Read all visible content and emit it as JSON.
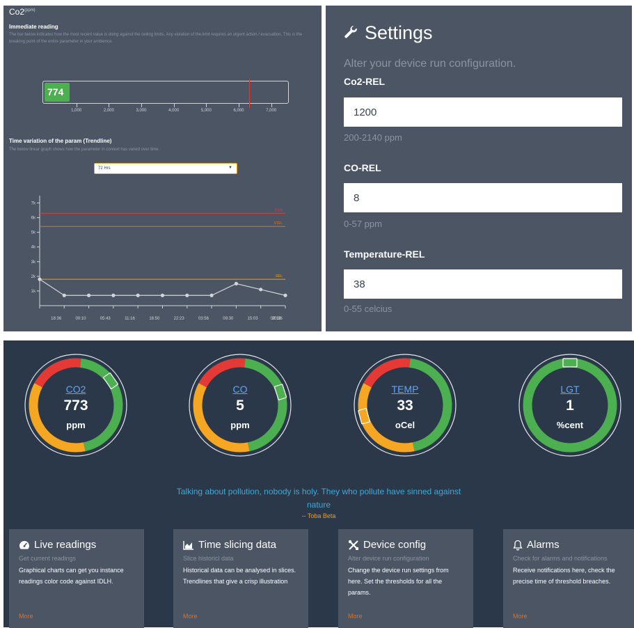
{
  "co2_panel": {
    "title": "Co2",
    "title_unit": "(ppm)",
    "immediate_heading": "Immediate reading",
    "immediate_desc": "The bar below indicates how the most recent value is doing against the ceiling limits. Any violation of the limit requires an urgent action / evacuation. This is the breaking point of the entire parameter in your ambience.",
    "current_value": "774",
    "bar_max": 7500,
    "limit_value": 6300,
    "scale_ticks": [
      "1,000",
      "2,000",
      "3,000",
      "4,000",
      "5,000",
      "6,000",
      "7,000"
    ],
    "trend_heading": "Time variation of the param (Trendline)",
    "trend_desc": "The below linear graph shows how the parameter in context has varied over time.",
    "range_select": "72 Hrs"
  },
  "chart_data": {
    "type": "line",
    "title": "",
    "x": [
      "18:36",
      "00:10",
      "05:43",
      "11:16",
      "16:50",
      "22:23",
      "03:56",
      "09:30",
      "15:03",
      "20:36",
      "02:10"
    ],
    "values": [
      1800,
      700,
      700,
      700,
      700,
      700,
      700,
      700,
      1500,
      1100,
      700
    ],
    "ylim": [
      0,
      7500
    ],
    "yticks": [
      "1k",
      "2k",
      "3k",
      "4k",
      "5k",
      "6k",
      "7k"
    ],
    "thresholds": [
      {
        "name": "IDLH",
        "value": 6300,
        "color": "#e53935"
      },
      {
        "name": "STEL",
        "value": 5400,
        "color": "#e2711d"
      },
      {
        "name": "REL",
        "value": 1800,
        "color": "#f59e0b"
      }
    ],
    "line_color": "#d1d5db"
  },
  "settings": {
    "title": "Settings",
    "subtitle": "Alter your device run configuration.",
    "fields": [
      {
        "label": "Co2-REL",
        "value": "1200",
        "hint": "200-2140 ppm"
      },
      {
        "label": "CO-REL",
        "value": "8",
        "hint": "0-57 ppm"
      },
      {
        "label": "Temperature-REL",
        "value": "38",
        "hint": "0-55 celcius"
      }
    ]
  },
  "gauges": [
    {
      "name": "CO2",
      "value": "773",
      "unit": "ppm",
      "segments": [
        {
          "color": "#e53935",
          "frac": 0.19
        },
        {
          "color": "#4caf50",
          "frac": 0.45
        },
        {
          "color": "#f5a623",
          "frac": 0.36
        }
      ],
      "start_deg": -62,
      "marker_deg": 55
    },
    {
      "name": "CO",
      "value": "5",
      "unit": "ppm",
      "segments": [
        {
          "color": "#e53935",
          "frac": 0.19
        },
        {
          "color": "#4caf50",
          "frac": 0.45
        },
        {
          "color": "#f5a623",
          "frac": 0.36
        }
      ],
      "start_deg": -62,
      "marker_deg": 72
    },
    {
      "name": "TEMP",
      "value": "33",
      "unit": "oCel",
      "segments": [
        {
          "color": "#e53935",
          "frac": 0.19
        },
        {
          "color": "#4caf50",
          "frac": 0.45
        },
        {
          "color": "#f5a623",
          "frac": 0.36
        }
      ],
      "start_deg": -62,
      "marker_deg": -105
    },
    {
      "name": "LGT",
      "value": "1",
      "unit": "%cent",
      "segments": [
        {
          "color": "#4caf50",
          "frac": 1.0
        }
      ],
      "start_deg": 0,
      "marker_deg": 0
    }
  ],
  "quote": {
    "text": "Talking about pollution, nobody is holy. They who pollute have sinned against nature",
    "author": "-- Toba Beta"
  },
  "cards": [
    {
      "icon": "dashboard-icon",
      "title": "Live readings",
      "subtitle": "Get current readings",
      "body": "Graphical charts can get you instance readings color code against IDLH.",
      "more": "More"
    },
    {
      "icon": "area-chart-icon",
      "title": "Time slicing data",
      "subtitle": "Slice historicl data",
      "body": "Historical data can be analysed in slices. Trendlines that give a crisp illustration",
      "more": "More"
    },
    {
      "icon": "tools-icon",
      "title": "Device config",
      "subtitle": "Alter device run configuration",
      "body": "Change the device run settings from here. Set the thresholds for all the params.",
      "more": "More"
    },
    {
      "icon": "bell-icon",
      "title": "Alarms",
      "subtitle": "Check for alarms and notifications",
      "body": "Receive notifications here, check the precise time of threshold breaches.",
      "more": "More"
    }
  ]
}
